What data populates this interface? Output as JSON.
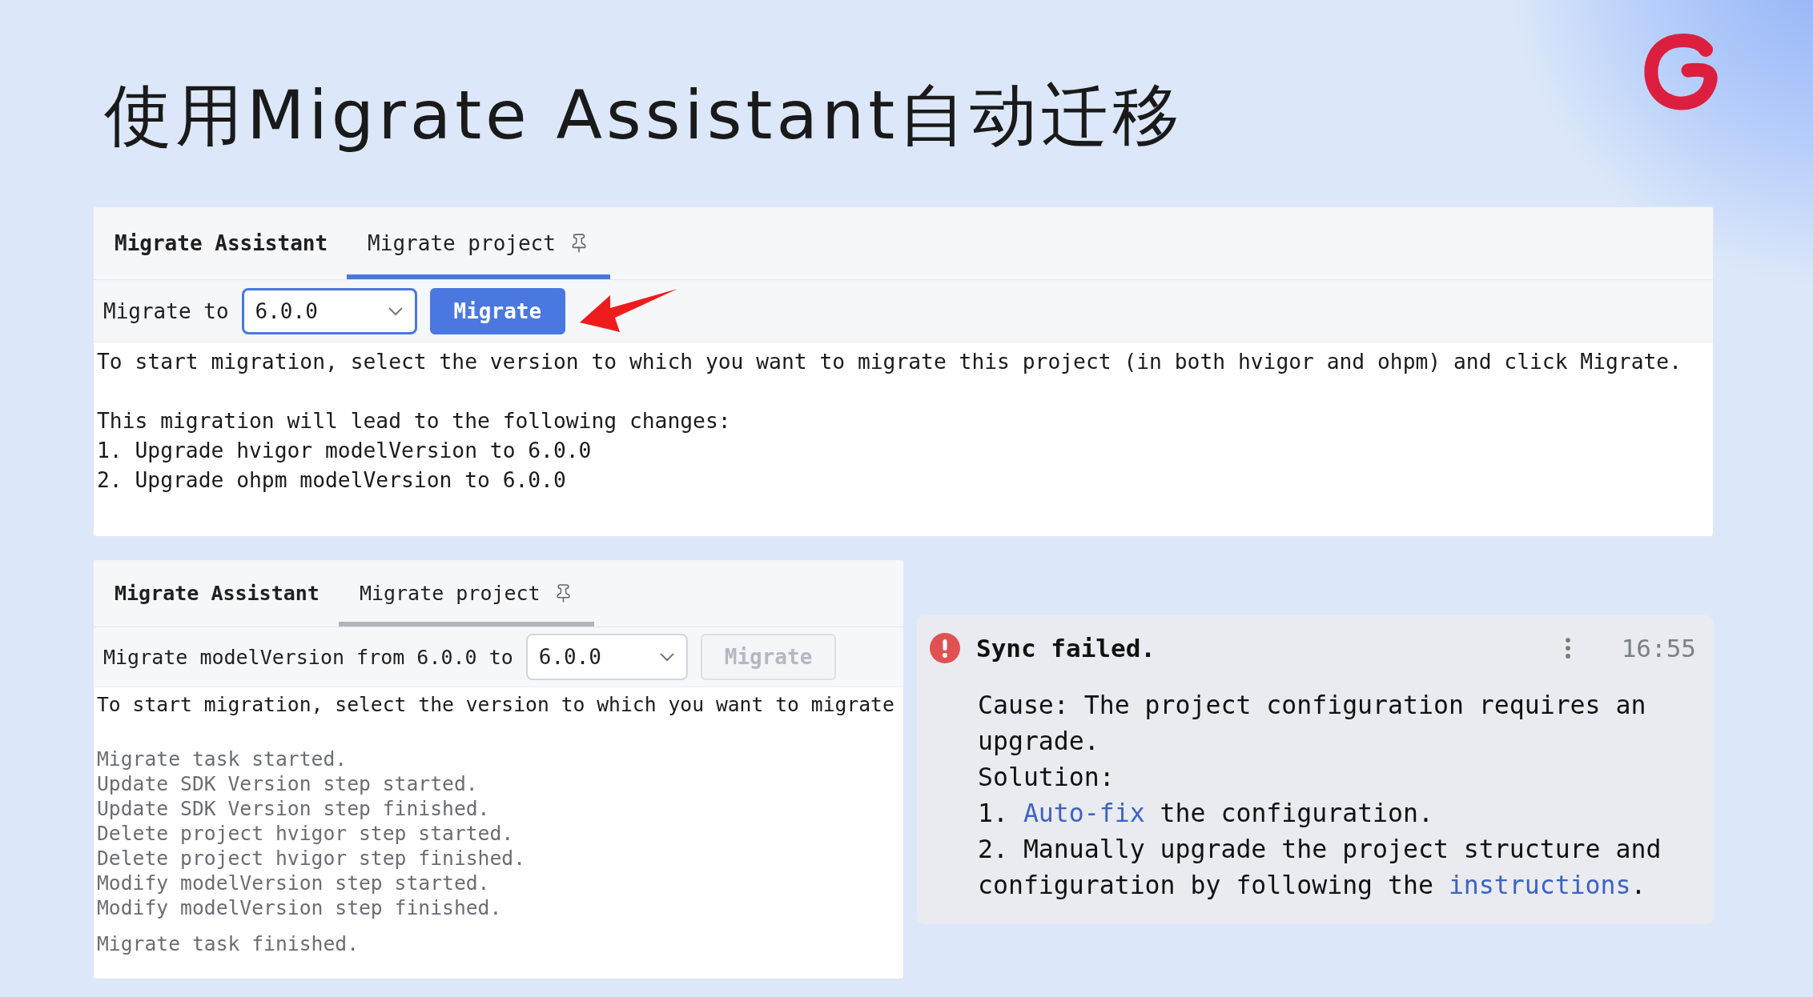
{
  "title": "使用Migrate Assistant自动迁移",
  "panels": [
    {
      "tool_title": "Migrate Assistant",
      "tab": {
        "label": "Migrate project",
        "selected": true,
        "focused": true
      },
      "label": "Migrate to",
      "version": "6.0.0",
      "dropdown_focused": true,
      "button": {
        "label": "Migrate",
        "disabled": false
      },
      "blocks": [
        {
          "kind": "message",
          "lines": [
            "To start migration, select the version to which you want to migrate this project (in both hvigor and ohpm) and click Migrate."
          ]
        },
        {
          "kind": "message",
          "lines": [
            "This migration will lead to the following changes:",
            "1. Upgrade hvigor modelVersion to 6.0.0",
            "2. Upgrade ohpm modelVersion to 6.0.0"
          ]
        }
      ]
    },
    {
      "tool_title": "Migrate Assistant",
      "tab": {
        "label": "Migrate project",
        "selected": true,
        "focused": false
      },
      "label": "Migrate modelVersion from 6.0.0 to",
      "version": "6.0.0",
      "dropdown_focused": false,
      "button": {
        "label": "Migrate",
        "disabled": true
      },
      "blocks": [
        {
          "kind": "message",
          "lines": [
            "To start migration, select the version to which you want to migrate"
          ]
        },
        {
          "kind": "log",
          "lines": [
            "Migrate task started.",
            "Update SDK Version step started.",
            "Update SDK Version step finished.",
            "Delete project hvigor step started.",
            "Delete project hvigor step finished.",
            "Modify modelVersion step started.",
            "Modify modelVersion step finished."
          ]
        },
        {
          "kind": "log",
          "lines": [
            "Migrate task finished."
          ]
        }
      ]
    }
  ],
  "notification": {
    "title": "Sync failed.",
    "time": "16:55",
    "paragraphs": [
      [
        {
          "text": "Cause: The project configuration requires an upgrade."
        }
      ],
      [
        {
          "text": "Solution:"
        }
      ],
      [
        {
          "text": "1. "
        },
        {
          "link": "Auto-fix"
        },
        {
          "text": " the configuration."
        }
      ],
      [
        {
          "text": "2. Manually upgrade the project structure and configuration by following the "
        },
        {
          "link": "instructions"
        },
        {
          "text": "."
        }
      ]
    ]
  }
}
